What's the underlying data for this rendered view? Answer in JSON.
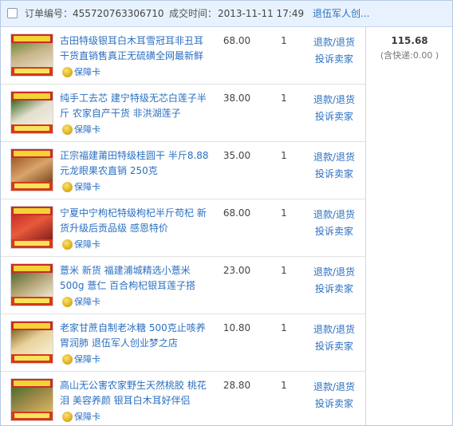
{
  "order": {
    "order_no_label": "订单编号：",
    "order_no": "455720763306710",
    "time_label": "成交时间：",
    "time": "2013-11-11 17:49",
    "shop": "退伍军人创..."
  },
  "items": [
    {
      "title": "古田特级银耳白木耳雪冠耳非丑耳干货直销售真正无硫磺全网最新鲜",
      "badge": "保障卡",
      "price": "68.00",
      "qty": "1",
      "action1": "退款/退货",
      "action2": "投诉卖家"
    },
    {
      "title": "纯手工去芯 建宁特级无芯白莲子半斤 农家自产干货 非洪湖莲子",
      "badge": "保障卡",
      "price": "38.00",
      "qty": "1",
      "action1": "退款/退货",
      "action2": "投诉卖家"
    },
    {
      "title": "正宗福建莆田特级桂圆干 半斤8.88元龙眼果农直销 250克",
      "badge": "保障卡",
      "price": "35.00",
      "qty": "1",
      "action1": "退款/退货",
      "action2": "投诉卖家"
    },
    {
      "title": "宁夏中宁枸杞特级枸杞半斤苟杞 新货升级后贡品级 感恩特价",
      "badge": "保障卡",
      "price": "68.00",
      "qty": "1",
      "action1": "退款/退货",
      "action2": "投诉卖家"
    },
    {
      "title": "薏米 新货 福建浦城精选小薏米500g 薏仁 百合枸杞银耳莲子搭",
      "badge": "保障卡",
      "price": "23.00",
      "qty": "1",
      "action1": "退款/退货",
      "action2": "投诉卖家"
    },
    {
      "title": "老家甘蔗自制老冰糖 500克止咳养胃润肺 退伍军人创业梦之店",
      "badge": "保障卡",
      "price": "10.80",
      "qty": "1",
      "action1": "退款/退货",
      "action2": "投诉卖家"
    },
    {
      "title": "高山无公害农家野生天然桃胶 桃花泪 美容养颜 银耳白木耳好伴侣",
      "badge": "保障卡",
      "price": "28.80",
      "qty": "1",
      "action1": "退款/退货",
      "action2": "投诉卖家"
    }
  ],
  "summary": {
    "total": "115.68",
    "shipping": "(含快递:0.00 )"
  },
  "colors": {
    "link": "#2b6fc1",
    "header_bg": "#e8f2ff",
    "border": "#b5c9e2"
  },
  "icons": {
    "badge_icon": "shield-icon"
  }
}
